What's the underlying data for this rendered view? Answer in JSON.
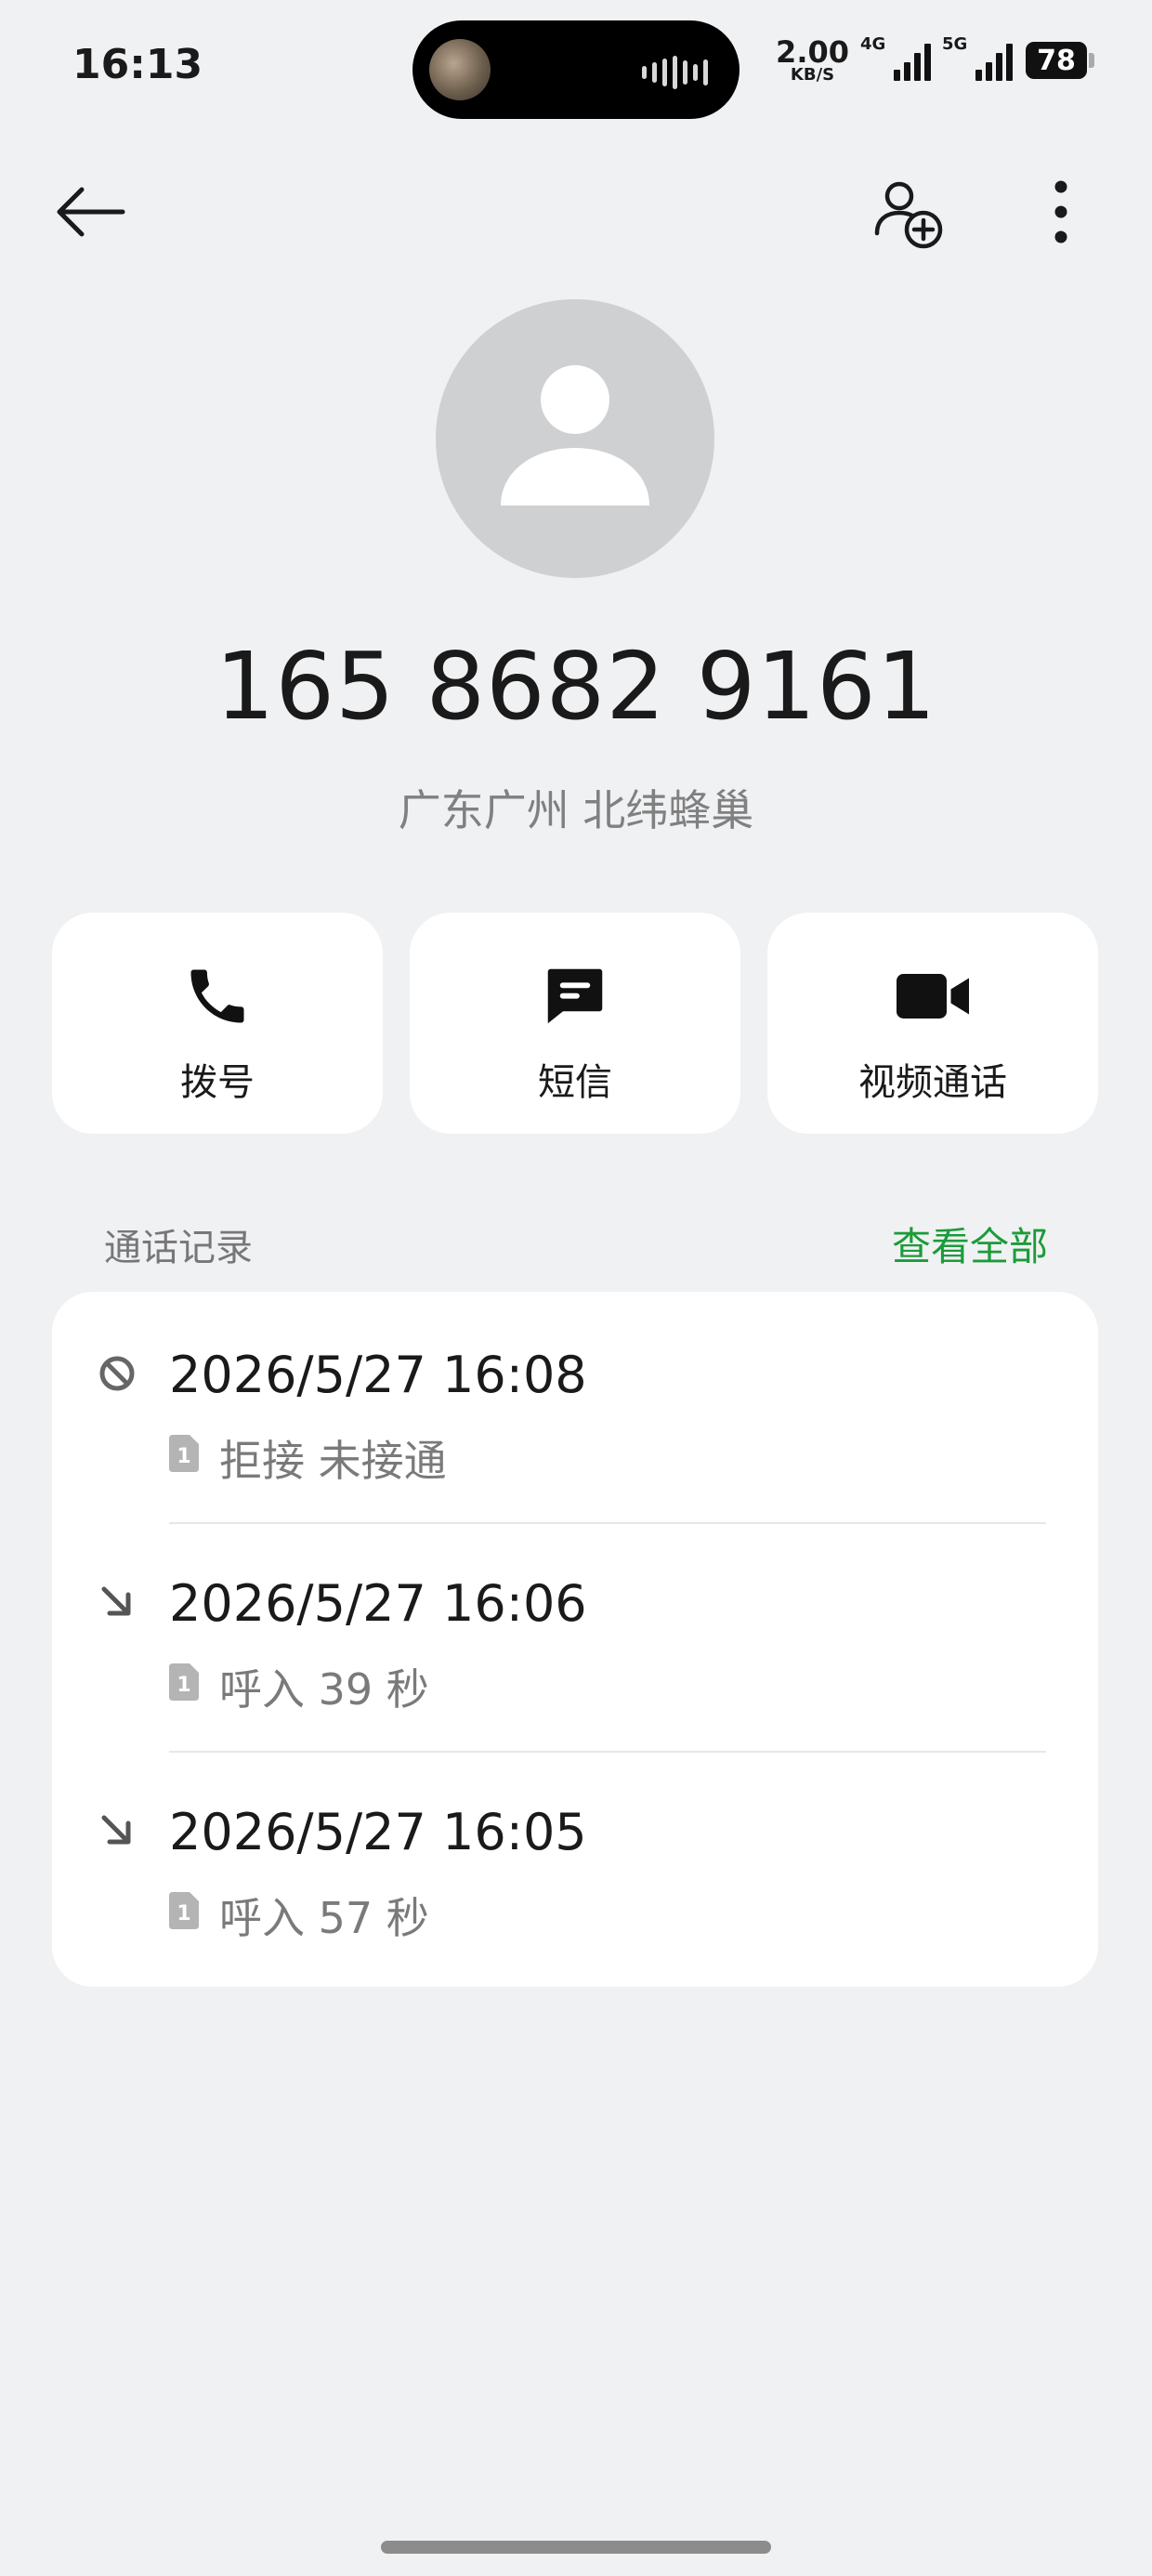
{
  "status_bar": {
    "time": "16:13",
    "speed_value": "2.00",
    "speed_unit": "KB/S",
    "net1": "4G",
    "net2": "5G",
    "battery": "78"
  },
  "header": {
    "back_icon": "arrow-left-icon",
    "add_contact_icon": "add-contact-icon",
    "more_icon": "more-vertical-icon"
  },
  "contact": {
    "avatar_icon": "person-placeholder-icon",
    "number": "165 8682 9161",
    "location": "广东广州 北纬蜂巢"
  },
  "actions": [
    {
      "label": "拨号",
      "icon": "phone-icon"
    },
    {
      "label": "短信",
      "icon": "message-icon"
    },
    {
      "label": "视频通话",
      "icon": "video-camera-icon"
    }
  ],
  "call_log": {
    "title": "通话记录",
    "see_all": "查看全部",
    "accent_color": "#1c9b3a",
    "sim_label": "1",
    "entries": [
      {
        "icon": "blocked-call-icon",
        "time": "2026/5/27 16:08",
        "detail": "拒接 未接通"
      },
      {
        "icon": "incoming-call-icon",
        "time": "2026/5/27 16:06",
        "detail": "呼入  39 秒"
      },
      {
        "icon": "incoming-call-icon",
        "time": "2026/5/27 16:05",
        "detail": "呼入  57 秒"
      }
    ]
  }
}
